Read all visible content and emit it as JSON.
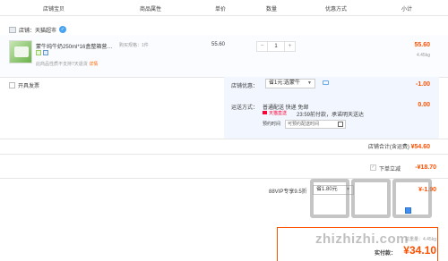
{
  "header": {
    "columns": [
      "店铺宝贝",
      "商品属性",
      "单价",
      "数量",
      "优惠方式",
      "小计"
    ]
  },
  "shop": {
    "name": "店铺：天猫超市"
  },
  "item": {
    "title": "蒙牛纯牛奶250ml*16盒整箱营…",
    "spec": "购买规格：1件",
    "price": "55.60",
    "quantity": "1",
    "minus": "−",
    "plus": "+",
    "note_text": "此商品性质不支持7天退货",
    "note_link": "详情",
    "subtotal": "55.60",
    "weight": "4.45kg"
  },
  "invoice": {
    "label": "开具发票"
  },
  "discount": {
    "label": "店铺优惠：",
    "selected": "省1元:选蒙牛",
    "amount": "-1.00"
  },
  "shipping": {
    "label": "运送方式：",
    "method": "普通配送 快递 免邮",
    "tmall_label": "天猫直送",
    "promise": "23:59前付款，承诺明天送达",
    "time_label": "预约时间",
    "time_placeholder": "可预约配送时间",
    "amount": "0.00"
  },
  "shop_total": {
    "label": "店铺合计(含运费)",
    "value": "¥54.60"
  },
  "order_discount": {
    "label": "下单立减",
    "value": "-¥18.70"
  },
  "vip": {
    "label": "88VIP专享9.5折",
    "selected": "省1.80元",
    "value": "¥-1.90"
  },
  "summary": {
    "weight": "总重量：4.45kg",
    "pay_label": "实付款：",
    "pay_value": "¥34.10"
  },
  "watermark": {
    "text": "zhizhizhi.com"
  }
}
